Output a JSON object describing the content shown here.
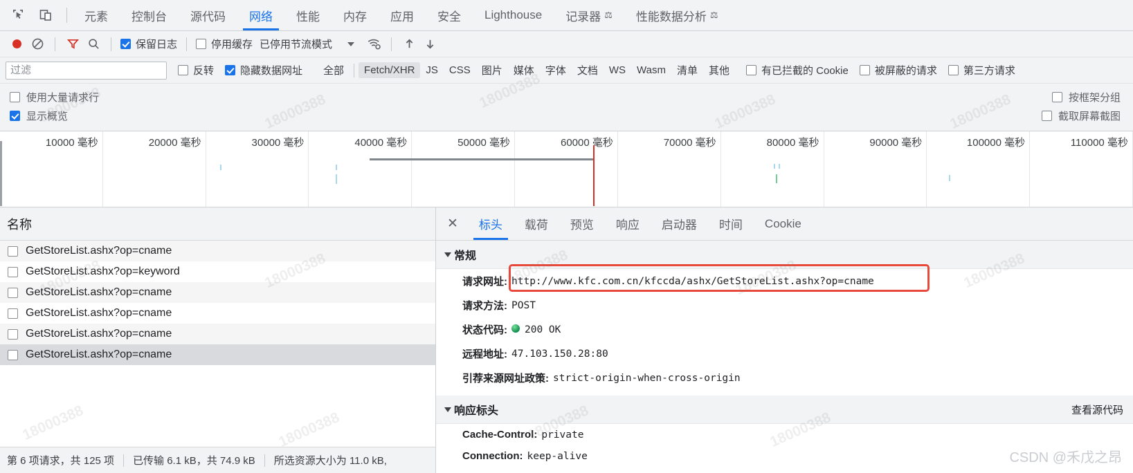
{
  "tabbar": {
    "icons": [
      {
        "name": "inspect-element-icon"
      },
      {
        "name": "device-toolbar-icon"
      }
    ],
    "tabs": [
      {
        "label": "元素",
        "active": false,
        "flask": false
      },
      {
        "label": "控制台",
        "active": false,
        "flask": false
      },
      {
        "label": "源代码",
        "active": false,
        "flask": false
      },
      {
        "label": "网络",
        "active": true,
        "flask": false
      },
      {
        "label": "性能",
        "active": false,
        "flask": false
      },
      {
        "label": "内存",
        "active": false,
        "flask": false
      },
      {
        "label": "应用",
        "active": false,
        "flask": false
      },
      {
        "label": "安全",
        "active": false,
        "flask": false
      },
      {
        "label": "Lighthouse",
        "active": false,
        "flask": false
      },
      {
        "label": "记录器",
        "active": false,
        "flask": true
      },
      {
        "label": "性能数据分析",
        "active": false,
        "flask": true
      }
    ]
  },
  "toolbar": {
    "record_title": "record-button",
    "clear_title": "clear-button",
    "filter_title": "filter-button",
    "search_title": "search-button",
    "preserve_log": {
      "label": "保留日志",
      "checked": true
    },
    "disable_cache": {
      "label": "停用缓存",
      "checked": false
    },
    "throttling": "已停用节流模式",
    "network_conditions_title": "network-conditions",
    "import_title": "import-har",
    "export_title": "export-har"
  },
  "filterbar": {
    "filter_placeholder": "过滤",
    "filter_value": "",
    "invert": {
      "label": "反转",
      "checked": false
    },
    "hide_data_urls": {
      "label": "隐藏数据网址",
      "checked": true
    },
    "types": [
      {
        "label": "全部",
        "selected": false
      },
      {
        "label": "Fetch/XHR",
        "selected": true
      },
      {
        "label": "JS",
        "selected": false
      },
      {
        "label": "CSS",
        "selected": false
      },
      {
        "label": "图片",
        "selected": false
      },
      {
        "label": "媒体",
        "selected": false
      },
      {
        "label": "字体",
        "selected": false
      },
      {
        "label": "文档",
        "selected": false
      },
      {
        "label": "WS",
        "selected": false
      },
      {
        "label": "Wasm",
        "selected": false
      },
      {
        "label": "清单",
        "selected": false
      },
      {
        "label": "其他",
        "selected": false
      }
    ],
    "blocked_cookies": {
      "label": "有已拦截的 Cookie",
      "checked": false
    },
    "blocked_requests": {
      "label": "被屏蔽的请求",
      "checked": false
    },
    "third_party": {
      "label": "第三方请求",
      "checked": false
    }
  },
  "settings": {
    "big_request_rows": {
      "label": "使用大量请求行",
      "checked": false
    },
    "group_by_frame": {
      "label": "按框架分组",
      "checked": false
    },
    "show_overview": {
      "label": "显示概览",
      "checked": true
    },
    "capture_screenshots": {
      "label": "截取屏幕截图",
      "checked": false
    }
  },
  "overview": {
    "ticks": [
      "10000 毫秒",
      "20000 毫秒",
      "30000 毫秒",
      "40000 毫秒",
      "50000 毫秒",
      "60000 毫秒",
      "70000 毫秒",
      "80000 毫秒",
      "90000 毫秒",
      "100000 毫秒",
      "110000 毫秒"
    ]
  },
  "requests": {
    "column_header": "名称",
    "rows": [
      {
        "name": "GetStoreList.ashx?op=cname",
        "selected": false
      },
      {
        "name": "GetStoreList.ashx?op=keyword",
        "selected": false
      },
      {
        "name": "GetStoreList.ashx?op=cname",
        "selected": false
      },
      {
        "name": "GetStoreList.ashx?op=cname",
        "selected": false
      },
      {
        "name": "GetStoreList.ashx?op=cname",
        "selected": false
      },
      {
        "name": "GetStoreList.ashx?op=cname",
        "selected": true
      }
    ]
  },
  "statusbar": {
    "requests": "第 6 项请求，共 125 项",
    "transferred": "已传输 6.1 kB，共 74.9 kB",
    "resources": "所选资源大小为 11.0 kB,"
  },
  "details": {
    "close_label": "✕",
    "tabs": [
      {
        "label": "标头",
        "active": true
      },
      {
        "label": "载荷",
        "active": false
      },
      {
        "label": "预览",
        "active": false
      },
      {
        "label": "响应",
        "active": false
      },
      {
        "label": "启动器",
        "active": false
      },
      {
        "label": "时间",
        "active": false
      },
      {
        "label": "Cookie",
        "active": false
      }
    ],
    "general": {
      "title": "常规",
      "items": [
        {
          "key": "请求网址:",
          "value": "http://www.kfc.com.cn/kfccda/ashx/GetStoreList.ashx?op=cname",
          "highlight": true
        },
        {
          "key": "请求方法:",
          "value": "POST",
          "highlight": false
        },
        {
          "key": "状态代码:",
          "value": "200 OK",
          "status": true,
          "highlight": false
        },
        {
          "key": "远程地址:",
          "value": "47.103.150.28:80",
          "highlight": false
        },
        {
          "key": "引荐来源网址政策:",
          "value": "strict-origin-when-cross-origin",
          "highlight": false
        }
      ]
    },
    "response_headers": {
      "title": "响应标头",
      "view_source": "查看源代码",
      "items": [
        {
          "key": "Cache-Control:",
          "value": "private"
        },
        {
          "key": "Connection:",
          "value": "keep-alive"
        }
      ]
    }
  },
  "watermark": {
    "text": "18000388",
    "credit": "CSDN @禾戊之昂"
  },
  "colors": {
    "accent": "#1a73e8",
    "record": "#d93025",
    "status_ok": "#0f9d58",
    "annotation": "#e8493a",
    "chrome_bg": "#f1f3f4"
  }
}
